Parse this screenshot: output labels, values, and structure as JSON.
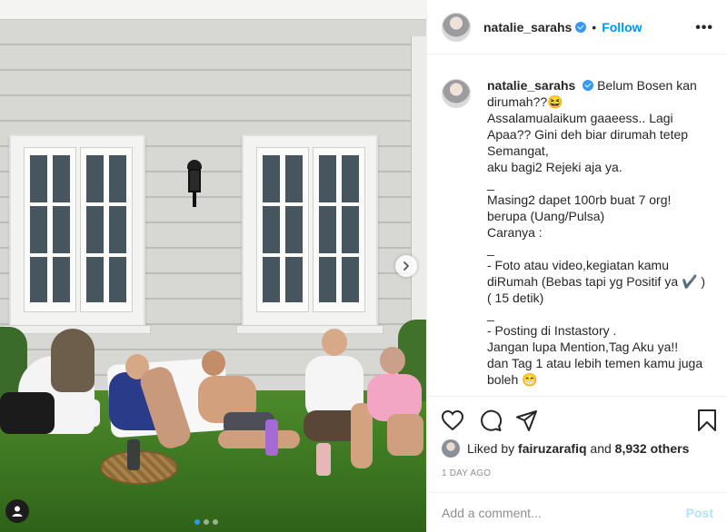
{
  "post": {
    "username": "natalie_sarahs",
    "separator": "•",
    "follow_label": "Follow",
    "more_icon": "more-options-icon",
    "caption_lines": [
      "Belum Bosen kan dirumah??😆",
      "Assalamualaikum gaaeess.. Lagi Apaa?? Gini deh biar dirumah tetep Semangat,",
      "aku bagi2 Rejeki aja ya.",
      "_",
      "Masing2 dapet 100rb buat 7 org! berupa (Uang/Pulsa)",
      "Caranya :",
      "_",
      "- Foto atau video,kegiatan kamu diRumah (Bebas tapi yg Positif ya ✔️ ) ( 15 detik)",
      "_",
      "- Posting di Instastory .",
      "Jangan lupa Mention,Tag Aku ya!!",
      "dan Tag 1 atau lebih temen kamu juga boleh 😁"
    ],
    "liked_by_prefix": "Liked by",
    "liked_by_user": "fairuzarafiq",
    "liked_by_and": "and",
    "liked_by_count": "8,932 others",
    "date": "1 DAY AGO",
    "comment_placeholder": "Add a comment...",
    "post_button": "Post",
    "carousel": {
      "total": 3,
      "active_index": 0
    }
  },
  "colors": {
    "link_blue": "#0095f6",
    "verified_blue": "#3897f0",
    "post_disabled": "#b2dffc",
    "muted": "#8e8e8e"
  }
}
